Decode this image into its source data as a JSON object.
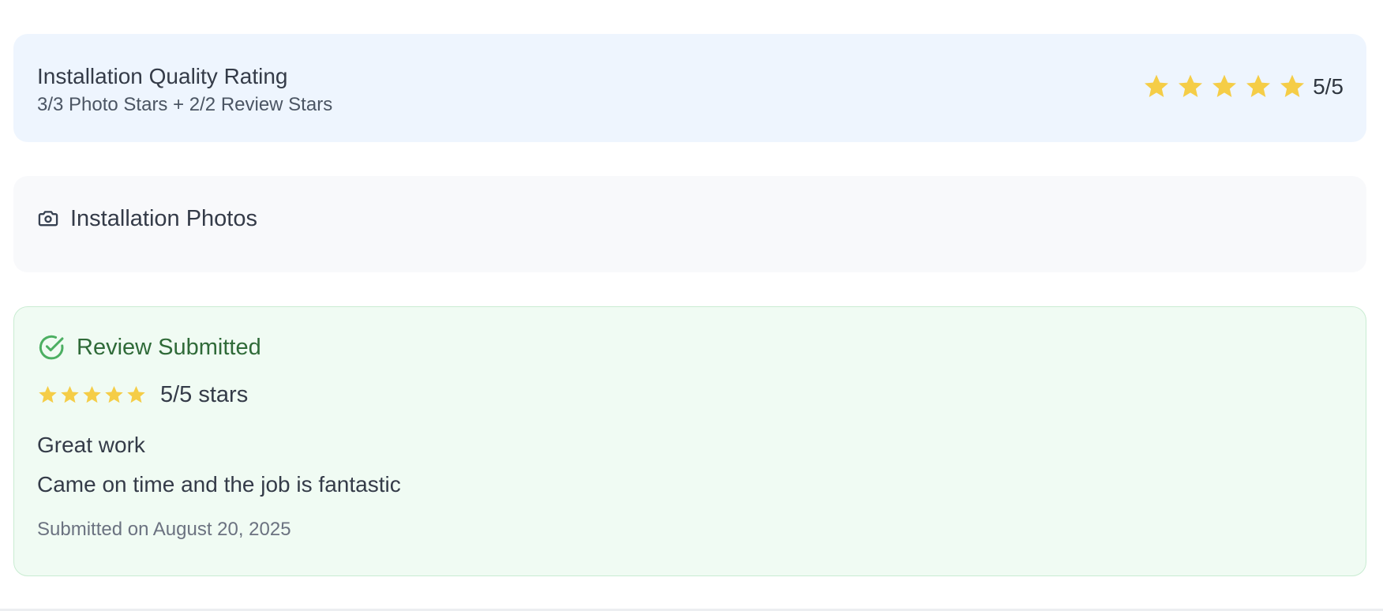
{
  "quality_rating": {
    "title": "Installation Quality Rating",
    "subtitle": "3/3 Photo Stars + 2/2 Review Stars",
    "stars_filled": 5,
    "stars_total": 5,
    "score_label": "5/5",
    "star_color": "#f5cd47"
  },
  "photos": {
    "icon": "camera-icon",
    "title": "Installation Photos"
  },
  "review": {
    "status_icon": "check-circle-icon",
    "status_label": "Review Submitted",
    "status_color": "#2f6a38",
    "rating": 5,
    "rating_max": 5,
    "stars_label": "5/5 stars",
    "title": "Great work",
    "body": "Came on time and the job is fantastic",
    "submitted_label": "Submitted on August 20, 2025"
  }
}
